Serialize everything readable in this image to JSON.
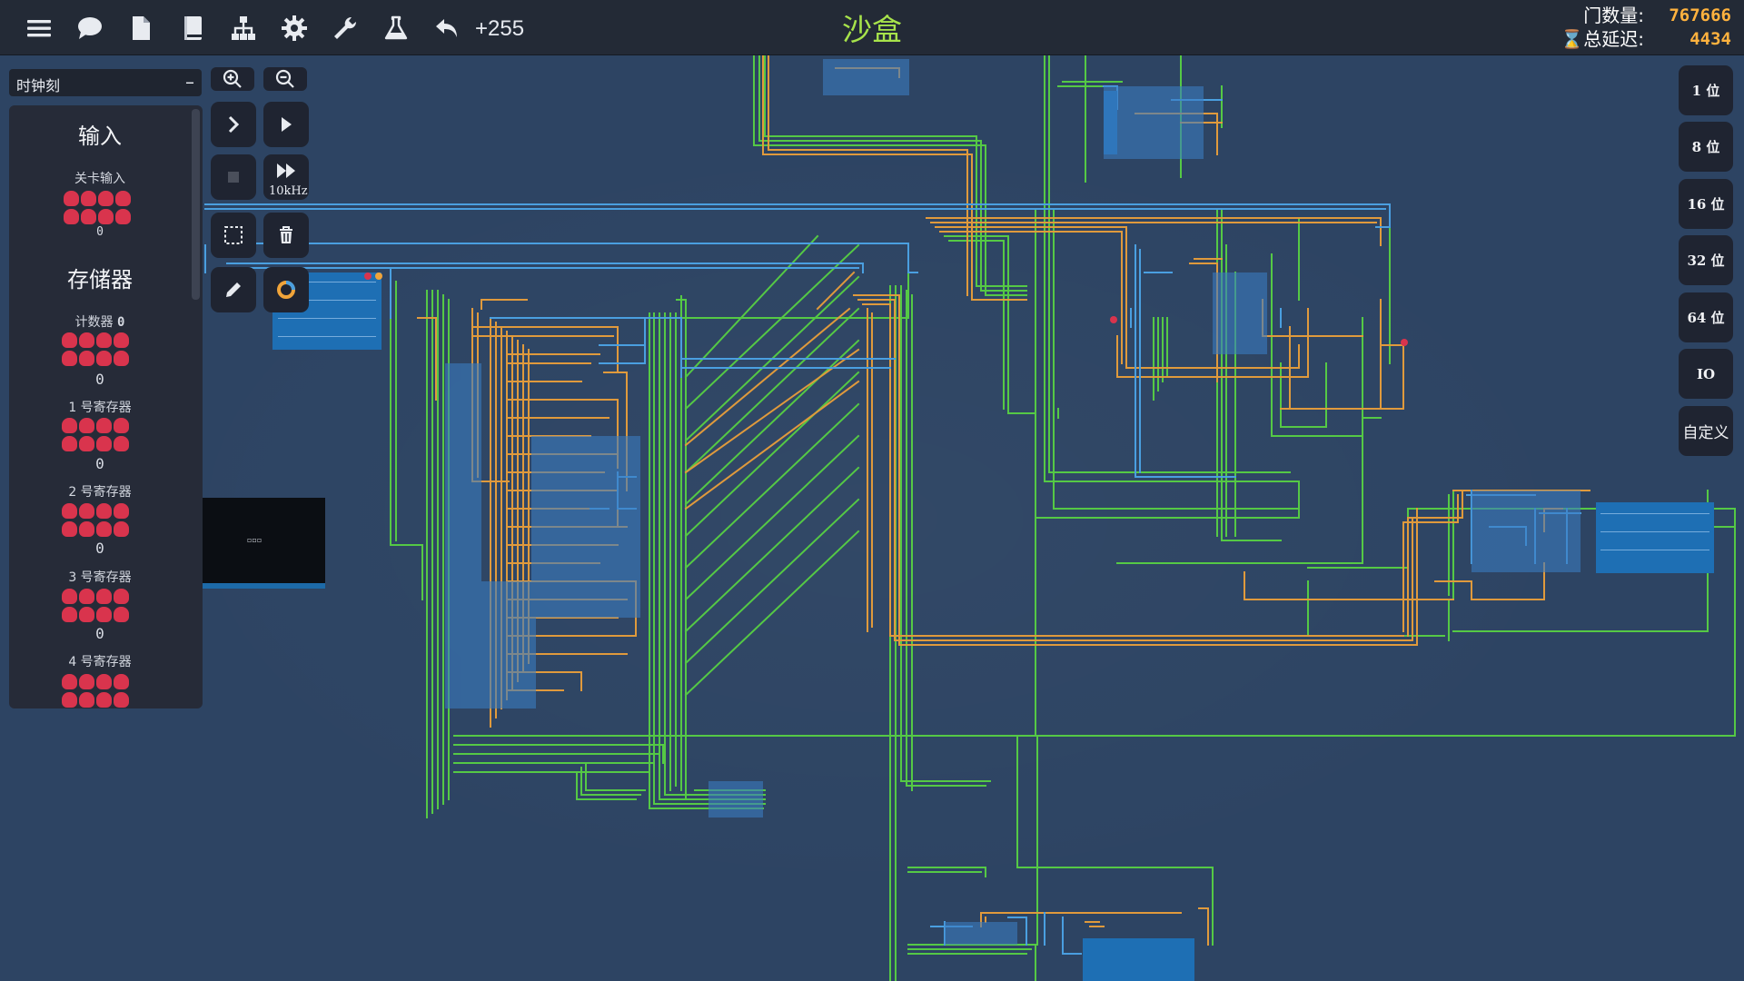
{
  "topbar": {
    "icons": [
      "menu-icon",
      "chat-icon",
      "file-icon",
      "book-icon",
      "hierarchy-icon",
      "gear-icon",
      "wrench-icon",
      "flask-icon",
      "undo-icon"
    ],
    "undo_count": "+255",
    "title": "沙盒",
    "stats": {
      "gate_label": "门数量:",
      "gate_value": "767666",
      "delay_label": "总延迟:",
      "delay_value": "4434"
    }
  },
  "sidebar": {
    "clock_select": "时钟刻",
    "sections": [
      {
        "title": "输入"
      },
      {
        "title": "存储器"
      }
    ],
    "components": [
      {
        "label": "关卡输入",
        "value": "0"
      },
      {
        "label": "计数器",
        "badge": "0",
        "value": "0"
      },
      {
        "label": "1 号寄存器",
        "value": "0"
      },
      {
        "label": "2 号寄存器",
        "value": "0"
      },
      {
        "label": "3 号寄存器",
        "value": "0"
      },
      {
        "label": "4 号寄存器",
        "value": ""
      }
    ]
  },
  "toolbar": {
    "speed_label": "10kHz",
    "tools": [
      "zoom-in",
      "zoom-out",
      "step",
      "run",
      "stop",
      "fast-forward",
      "select",
      "delete",
      "pencil",
      "color-ring"
    ]
  },
  "palette": {
    "items": [
      "1 位",
      "8 位",
      "16 位",
      "32 位",
      "64 位",
      "IO",
      "自定义"
    ]
  },
  "colors": {
    "wire_green": "#55c945",
    "wire_orange": "#e09a3c",
    "wire_blue": "#4a9fe0",
    "pin_red": "#d9344d",
    "title_green": "#a7e34b",
    "stat_orange": "#ffb23e"
  }
}
